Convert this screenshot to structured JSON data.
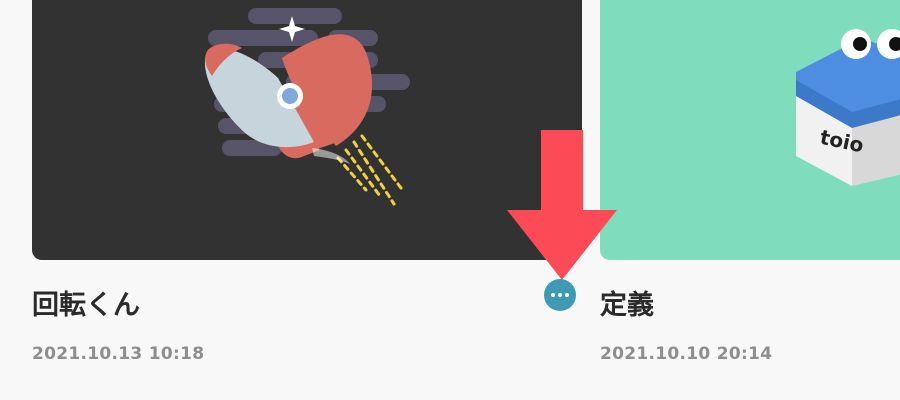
{
  "cards": [
    {
      "title": "回転くん",
      "date": "2021.10.13 10:18",
      "thumbnail_icon": "rocket-icon",
      "thumbnail_bg": "#323232"
    },
    {
      "title": "定義",
      "date": "2021.10.10 20:14",
      "thumbnail_icon": "toio-cube-icon",
      "thumbnail_bg": "#7fdcbc",
      "cube_label": "toio"
    }
  ],
  "more_button": {
    "icon": "more-dots-icon",
    "color": "#3f9ab3"
  },
  "annotation": {
    "icon": "down-arrow-icon",
    "color": "#fc4a57"
  }
}
